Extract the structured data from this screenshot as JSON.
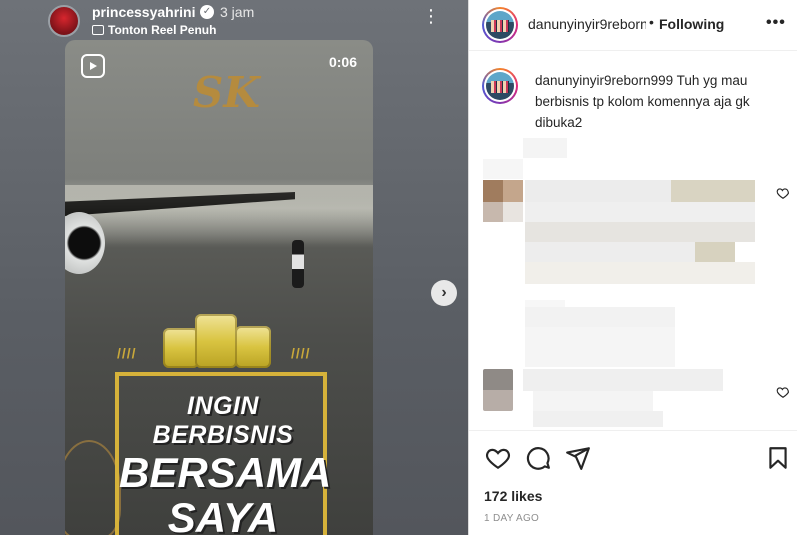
{
  "story": {
    "username": "princessyahrini",
    "verified_mark": "✓",
    "time": "3 jam",
    "reel_link": "Tonton Reel Penuh",
    "more": "⋮",
    "video_time": "0:06",
    "logo_mark": "SK",
    "headline_1": "INGIN BERBISNIS",
    "headline_2": "BERSAMA",
    "headline_3": "SAYA",
    "stripes_left": "////",
    "stripes_right": "////"
  },
  "nav": {
    "next": "›"
  },
  "post": {
    "username": "danunyinyir9reborn999",
    "separator": "•",
    "follow_state": "Following",
    "more": "•••",
    "caption_user": "danunyinyir9reborn999",
    "caption_text": "Tuh yg mau berbisnis tp kolom komennya aja gk dibuka2",
    "likes": "172 likes",
    "date": "1 DAY AGO"
  },
  "icons": {
    "like": "heart-icon",
    "comment": "comment-icon",
    "share": "share-icon",
    "save": "bookmark-icon",
    "reel": "reel-icon",
    "next": "chevron-right-icon"
  }
}
